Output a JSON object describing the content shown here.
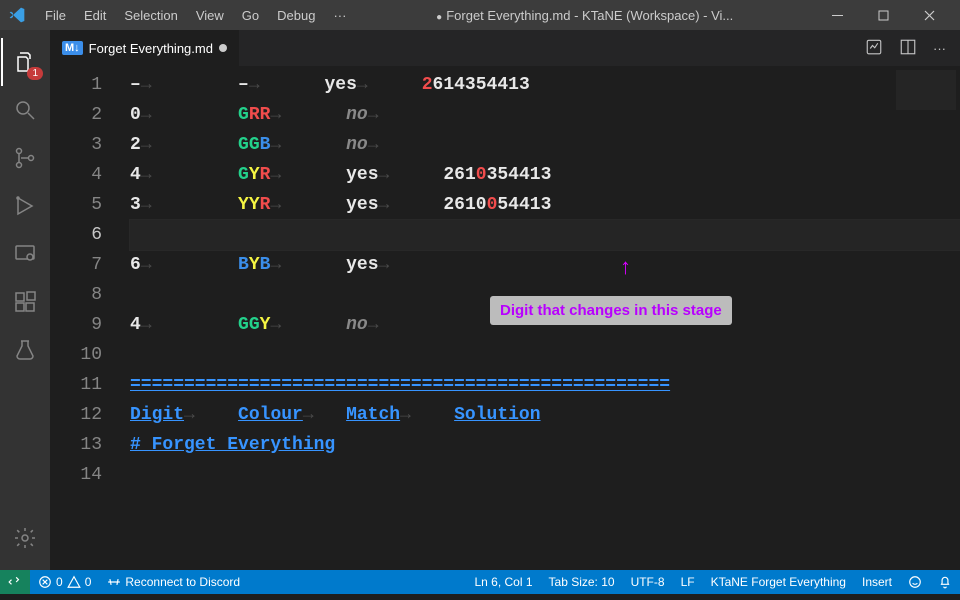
{
  "window": {
    "title": "Forget Everything.md - KTaNE (Workspace) - Vi..."
  },
  "menu": {
    "file": "File",
    "edit": "Edit",
    "selection": "Selection",
    "view": "View",
    "go": "Go",
    "debug": "Debug",
    "more": "···"
  },
  "activity": {
    "explorer_badge": "1"
  },
  "tab": {
    "icon": "M↓",
    "label": "Forget Everything.md"
  },
  "gutter": [
    "1",
    "2",
    "3",
    "4",
    "5",
    "6",
    "7",
    "8",
    "9",
    "10",
    "11",
    "12",
    "13",
    "14"
  ],
  "rows": [
    {
      "digit": "–",
      "colors": [
        [
          "–",
          "white"
        ]
      ],
      "match": "yes",
      "solution": [
        [
          "2",
          "red"
        ],
        [
          "614354413",
          "num"
        ]
      ]
    },
    {
      "digit": "0",
      "colors": [
        [
          "G",
          "green"
        ],
        [
          "R",
          "red"
        ],
        [
          "R",
          "red"
        ]
      ],
      "match": "no",
      "solution": []
    },
    {
      "digit": "2",
      "colors": [
        [
          "G",
          "green"
        ],
        [
          "G",
          "green"
        ],
        [
          "B",
          "blue"
        ]
      ],
      "match": "no",
      "solution": []
    },
    {
      "digit": "4",
      "colors": [
        [
          "G",
          "green"
        ],
        [
          "Y",
          "yellow"
        ],
        [
          "R",
          "red"
        ]
      ],
      "match": "yes",
      "solution": [
        [
          "261",
          "num"
        ],
        [
          "0",
          "red"
        ],
        [
          "354413",
          "num"
        ]
      ]
    },
    {
      "digit": "3",
      "colors": [
        [
          "Y",
          "yellow"
        ],
        [
          "Y",
          "yellow"
        ],
        [
          "R",
          "red"
        ]
      ],
      "match": "yes",
      "solution": [
        [
          "2610",
          "num"
        ],
        [
          "0",
          "red"
        ],
        [
          "54413",
          "num"
        ]
      ]
    },
    {
      "empty": true
    },
    {
      "digit": "6",
      "colors": [
        [
          "B",
          "blue"
        ],
        [
          "Y",
          "yellow"
        ],
        [
          "B",
          "blue"
        ]
      ],
      "match": "yes",
      "solution": []
    },
    {
      "blank": true
    },
    {
      "digit": "4",
      "colors": [
        [
          "G",
          "green"
        ],
        [
          "G",
          "green"
        ],
        [
          "Y",
          "yellow"
        ]
      ],
      "match": "no",
      "solution": []
    }
  ],
  "divider": "==================================================",
  "headers": {
    "digit": "Digit",
    "colour": "Colour",
    "match": "Match",
    "solution": "Solution"
  },
  "heading": "# Forget Everything",
  "tooltip": "Digit that changes in this stage",
  "status": {
    "errors": "0",
    "warnings": "0",
    "reconnect": "Reconnect to Discord",
    "cursor": "Ln 6, Col 1",
    "tabsize": "Tab Size: 10",
    "encoding": "UTF-8",
    "eol": "LF",
    "lang": "KTaNE Forget Everything",
    "mode": "Insert"
  }
}
